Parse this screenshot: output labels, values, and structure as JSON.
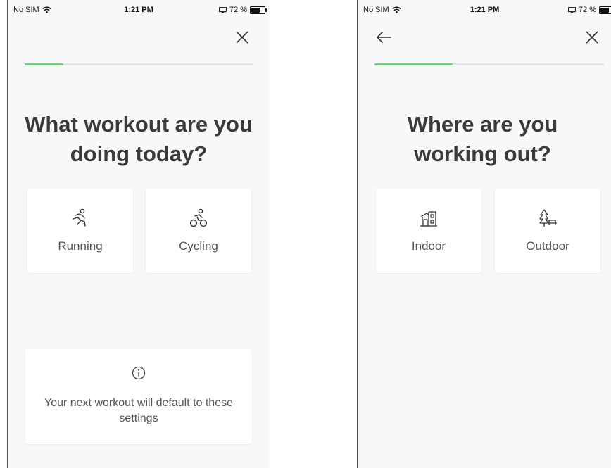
{
  "screens": [
    {
      "status": {
        "carrier": "No SIM",
        "time": "1:21 PM",
        "battery": "72 %",
        "battery_level": 0.72
      },
      "progress": 0.17,
      "title_line1": "What workout are you",
      "title_line2": "doing today?",
      "options": [
        {
          "label": "Running",
          "icon": "running-icon"
        },
        {
          "label": "Cycling",
          "icon": "cycling-icon"
        }
      ],
      "info_message": "Your next workout will default to these settings"
    },
    {
      "status": {
        "carrier": "No SIM",
        "time": "1:21 PM",
        "battery": "72 %",
        "battery_level": 0.72
      },
      "progress": 0.34,
      "title_line1": "Where are you",
      "title_line2": "working out?",
      "options": [
        {
          "label": "Indoor",
          "icon": "indoor-icon"
        },
        {
          "label": "Outdoor",
          "icon": "outdoor-icon"
        }
      ]
    }
  ],
  "colors": {
    "progress": "#6dd475",
    "background": "#f8f7f9",
    "card": "#ffffff",
    "text": "#3a3a3a"
  }
}
